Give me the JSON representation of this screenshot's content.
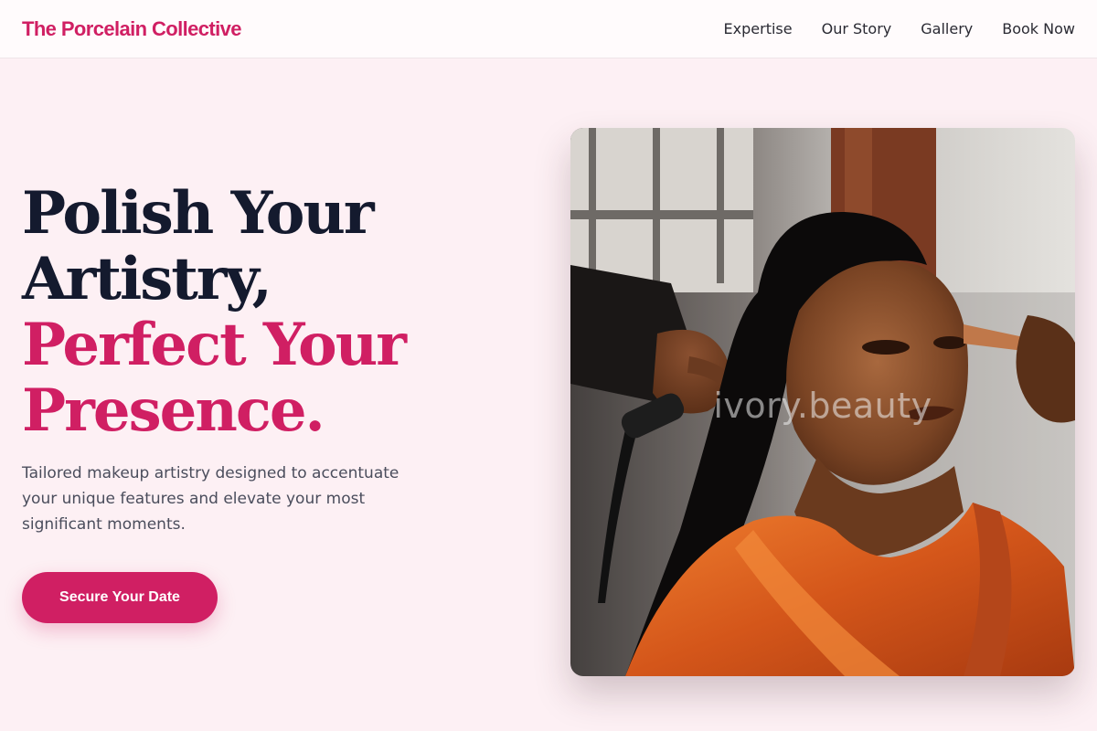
{
  "brand": {
    "name": "The Porcelain Collective"
  },
  "nav": {
    "items": [
      {
        "label": "Expertise"
      },
      {
        "label": "Our Story"
      },
      {
        "label": "Gallery"
      },
      {
        "label": "Book Now"
      }
    ]
  },
  "hero": {
    "headline_line1": "Polish Your",
    "headline_line2": "Artistry,",
    "headline_accent_line1": "Perfect Your",
    "headline_accent_line2": "Presence.",
    "subtitle": "Tailored makeup artistry designed to accentuate your unique features and elevate your most significant moments.",
    "cta_label": "Secure Your Date"
  },
  "photo": {
    "watermark": "ivory.beauty"
  },
  "colors": {
    "accent": "#d01f63",
    "heading_dark": "#141a2e",
    "background": "#fdf0f4"
  }
}
